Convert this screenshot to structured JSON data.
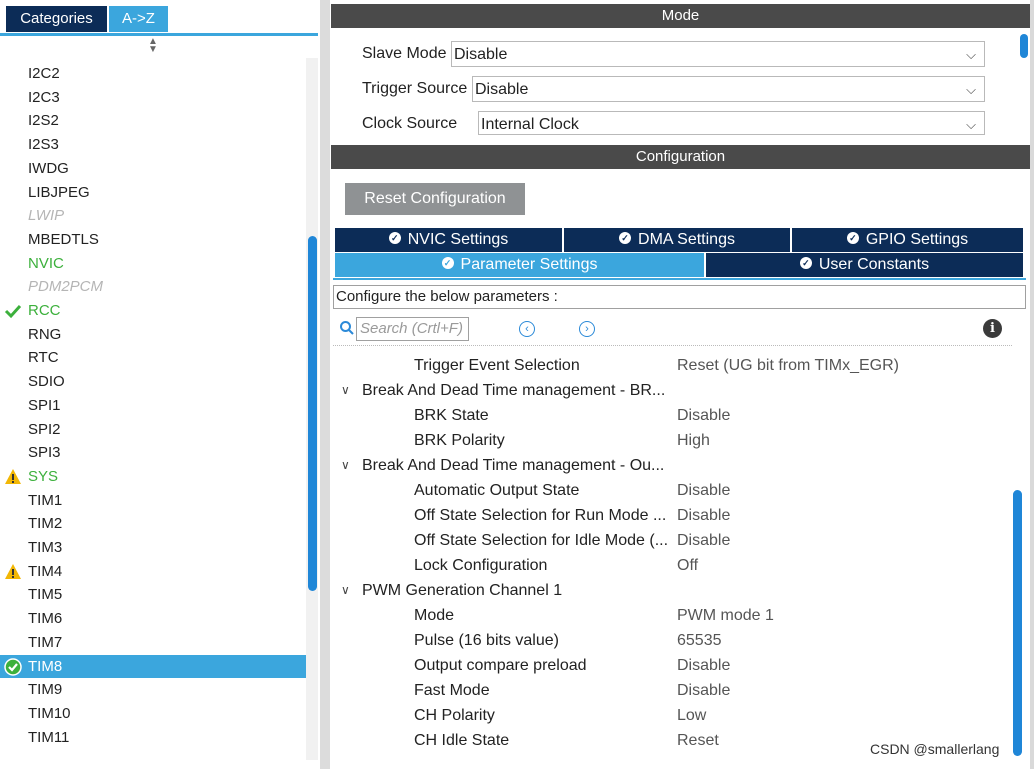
{
  "left_tabs": {
    "categories": "Categories",
    "az": "A->Z"
  },
  "peripherals": [
    {
      "label": "I2C2",
      "state": "normal"
    },
    {
      "label": "I2C3",
      "state": "normal"
    },
    {
      "label": "I2S2",
      "state": "normal"
    },
    {
      "label": "I2S3",
      "state": "normal"
    },
    {
      "label": "IWDG",
      "state": "normal"
    },
    {
      "label": "LIBJPEG",
      "state": "normal"
    },
    {
      "label": "LWIP",
      "state": "disabled"
    },
    {
      "label": "MBEDTLS",
      "state": "normal"
    },
    {
      "label": "NVIC",
      "state": "green"
    },
    {
      "label": "PDM2PCM",
      "state": "disabled"
    },
    {
      "label": "RCC",
      "state": "green",
      "icon": "check-icon"
    },
    {
      "label": "RNG",
      "state": "normal"
    },
    {
      "label": "RTC",
      "state": "normal"
    },
    {
      "label": "SDIO",
      "state": "normal"
    },
    {
      "label": "SPI1",
      "state": "normal"
    },
    {
      "label": "SPI2",
      "state": "normal"
    },
    {
      "label": "SPI3",
      "state": "normal"
    },
    {
      "label": "SYS",
      "state": "green",
      "icon": "warning-icon"
    },
    {
      "label": "TIM1",
      "state": "normal"
    },
    {
      "label": "TIM2",
      "state": "normal"
    },
    {
      "label": "TIM3",
      "state": "normal"
    },
    {
      "label": "TIM4",
      "state": "normal",
      "icon": "warning-icon"
    },
    {
      "label": "TIM5",
      "state": "normal"
    },
    {
      "label": "TIM6",
      "state": "normal"
    },
    {
      "label": "TIM7",
      "state": "normal"
    },
    {
      "label": "TIM8",
      "state": "selected",
      "icon": "check-circle-icon"
    },
    {
      "label": "TIM9",
      "state": "normal"
    },
    {
      "label": "TIM10",
      "state": "normal"
    },
    {
      "label": "TIM11",
      "state": "normal"
    }
  ],
  "mode": {
    "header": "Mode",
    "slave_mode_label": "Slave Mode",
    "slave_mode_value": "Disable",
    "trigger_source_label": "Trigger Source",
    "trigger_source_value": "Disable",
    "clock_source_label": "Clock Source",
    "clock_source_value": "Internal Clock"
  },
  "config": {
    "header": "Configuration",
    "reset_label": "Reset Configuration",
    "tabs": {
      "nvic": "NVIC Settings",
      "dma": "DMA Settings",
      "gpio": "GPIO Settings",
      "param": "Parameter Settings",
      "user": "User Constants"
    },
    "configure_text": "Configure the below parameters :",
    "search_placeholder": "Search (Crtl+F)"
  },
  "params": [
    {
      "type": "param",
      "name": "Trigger Event Selection",
      "value": "Reset (UG bit from TIMx_EGR)"
    },
    {
      "type": "group",
      "name": "Break And Dead Time management - BR..."
    },
    {
      "type": "param",
      "name": "BRK State",
      "value": "Disable"
    },
    {
      "type": "param",
      "name": "BRK Polarity",
      "value": "High"
    },
    {
      "type": "group",
      "name": "Break And Dead Time management - Ou..."
    },
    {
      "type": "param",
      "name": "Automatic Output State",
      "value": "Disable"
    },
    {
      "type": "param",
      "name": "Off State Selection for Run Mode ...",
      "value": "Disable"
    },
    {
      "type": "param",
      "name": "Off State Selection for Idle Mode (...",
      "value": "Disable"
    },
    {
      "type": "param",
      "name": "Lock Configuration",
      "value": "Off"
    },
    {
      "type": "group",
      "name": "PWM Generation Channel 1"
    },
    {
      "type": "param",
      "name": "Mode",
      "value": "PWM mode 1"
    },
    {
      "type": "param",
      "name": "Pulse (16 bits value)",
      "value": "65535"
    },
    {
      "type": "param",
      "name": "Output compare preload",
      "value": "Disable"
    },
    {
      "type": "param",
      "name": "Fast Mode",
      "value": "Disable"
    },
    {
      "type": "param",
      "name": "CH Polarity",
      "value": "Low"
    },
    {
      "type": "param",
      "name": "CH Idle State",
      "value": "Reset"
    }
  ],
  "watermark": "CSDN @smallerlang",
  "colors": {
    "navy": "#0c2c57",
    "accent": "#3ba6dd",
    "green": "#3cb03c",
    "warning": "#f2b705"
  }
}
